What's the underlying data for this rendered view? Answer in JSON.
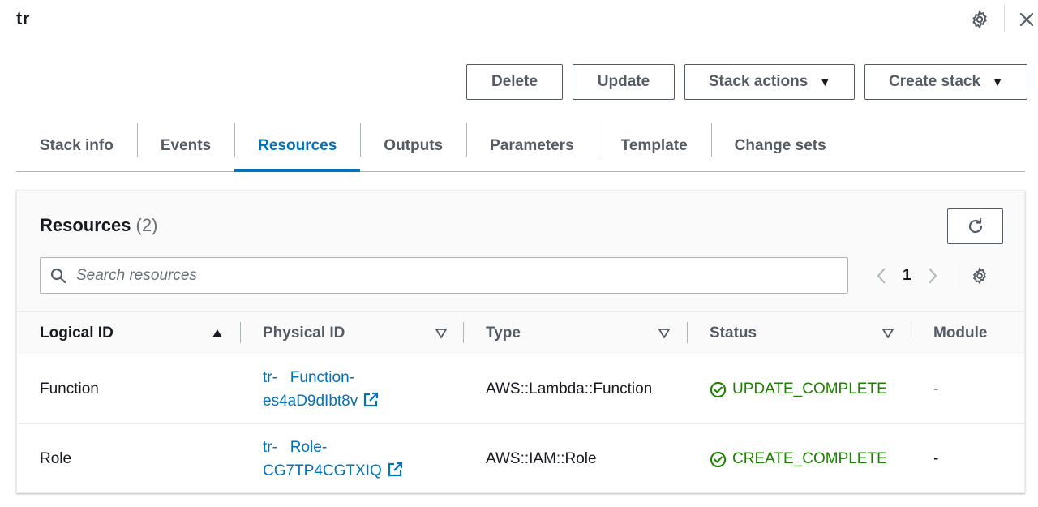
{
  "stack": {
    "title": "tr"
  },
  "actions": {
    "delete": "Delete",
    "update": "Update",
    "stack_actions": "Stack actions",
    "create_stack": "Create stack"
  },
  "tabs": [
    {
      "label": "Stack info",
      "active": false
    },
    {
      "label": "Events",
      "active": false
    },
    {
      "label": "Resources",
      "active": true
    },
    {
      "label": "Outputs",
      "active": false
    },
    {
      "label": "Parameters",
      "active": false
    },
    {
      "label": "Template",
      "active": false
    },
    {
      "label": "Change sets",
      "active": false
    }
  ],
  "resources": {
    "title": "Resources",
    "count": "(2)",
    "search_placeholder": "Search resources",
    "page": "1",
    "columns": {
      "logical_id": "Logical ID",
      "physical_id": "Physical ID",
      "type": "Type",
      "status": "Status",
      "module": "Module"
    },
    "rows": [
      {
        "logical_id": "Function",
        "physical_id_line1": "tr-   Function-",
        "physical_id_line2": "es4aD9dIbt8v",
        "type": "AWS::Lambda::Function",
        "status": "UPDATE_COMPLETE",
        "module": "-"
      },
      {
        "logical_id": "Role",
        "physical_id_line1": "tr-   Role-",
        "physical_id_line2": "CG7TP4CGTXIQ",
        "type": "AWS::IAM::Role",
        "status": "CREATE_COMPLETE",
        "module": "-"
      }
    ]
  },
  "colors": {
    "accent": "#0073bb",
    "success": "#1d8102",
    "text": "#16191f",
    "muted": "#545b64"
  },
  "icons": {
    "settings": "gear-icon",
    "close": "close-icon",
    "refresh": "refresh-icon",
    "search": "search-icon",
    "external": "external-link-icon",
    "status_ok": "check-circle-icon"
  }
}
